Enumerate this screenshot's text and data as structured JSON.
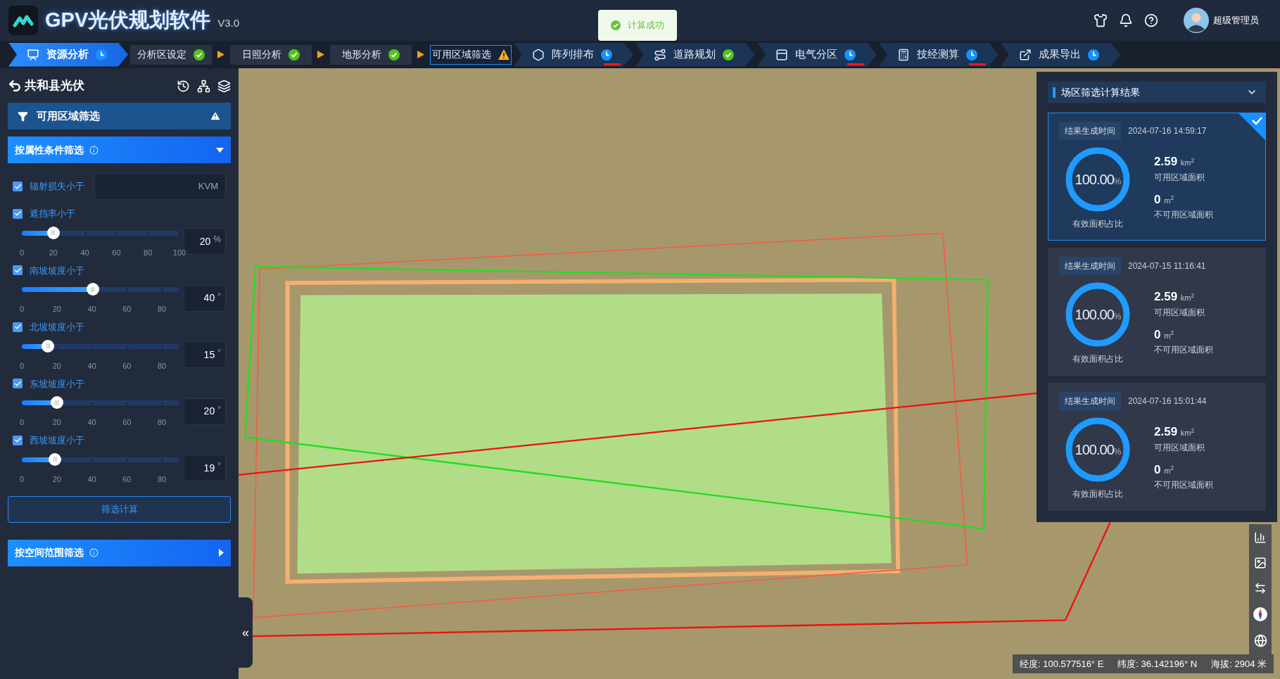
{
  "header": {
    "title": "GPV光伏规划软件",
    "version": "V3.0",
    "user": "超级管理员"
  },
  "toast": {
    "message": "计算成功"
  },
  "steps": [
    {
      "kind": "main",
      "label": "资源分析",
      "completed": false,
      "warning": false,
      "selected": true,
      "flagged": false
    },
    {
      "kind": "sub",
      "label": "分析区设定",
      "completed": true,
      "warning": false,
      "selected": false,
      "flagged": false
    },
    {
      "kind": "sub",
      "label": "日照分析",
      "completed": true,
      "warning": false,
      "selected": false,
      "flagged": false
    },
    {
      "kind": "sub",
      "label": "地形分析",
      "completed": true,
      "warning": false,
      "selected": false,
      "flagged": false
    },
    {
      "kind": "sub",
      "label": "可用区域筛选",
      "completed": false,
      "warning": true,
      "selected": true,
      "flagged": false
    },
    {
      "kind": "main",
      "label": "阵列排布",
      "completed": false,
      "warning": false,
      "selected": false,
      "flagged": true
    },
    {
      "kind": "main",
      "label": "道路规划",
      "completed": true,
      "warning": false,
      "selected": false,
      "flagged": false
    },
    {
      "kind": "main",
      "label": "电气分区",
      "completed": false,
      "warning": false,
      "selected": false,
      "flagged": true
    },
    {
      "kind": "main",
      "label": "技经测算",
      "completed": false,
      "warning": false,
      "selected": false,
      "flagged": true
    },
    {
      "kind": "main",
      "label": "成果导出",
      "completed": false,
      "warning": false,
      "selected": false,
      "flagged": false
    }
  ],
  "project": {
    "name": "共和县光伏"
  },
  "filter_panel": {
    "title": "可用区域筛选",
    "sections": [
      {
        "title": "按属性条件筛选",
        "expanded": true,
        "button": "筛选计算",
        "criteria": [
          {
            "kind": "input",
            "label": "辐射损失小于",
            "checked": true,
            "unit": "KVM"
          },
          {
            "kind": "slider",
            "label": "遮挡率小于",
            "checked": true,
            "level": 0.2,
            "value": "20",
            "unit": "%",
            "ticks": [
              "0",
              "20",
              "40",
              "60",
              "80",
              "100"
            ]
          },
          {
            "kind": "slider",
            "label": "南坡坡度小于",
            "checked": true,
            "level": 0.45,
            "value": "40",
            "unit": "°",
            "ticks": [
              "0",
              "20",
              "40",
              "60",
              "80"
            ]
          },
          {
            "kind": "slider",
            "label": "北坡坡度小于",
            "checked": true,
            "level": 0.167,
            "value": "15",
            "unit": "°",
            "ticks": [
              "0",
              "20",
              "40",
              "60",
              "80"
            ]
          },
          {
            "kind": "slider",
            "label": "东坡坡度小于",
            "checked": true,
            "level": 0.222,
            "value": "20",
            "unit": "°",
            "ticks": [
              "0",
              "20",
              "40",
              "60",
              "80"
            ]
          },
          {
            "kind": "slider",
            "label": "西坡坡度小于",
            "checked": true,
            "level": 0.211,
            "value": "19",
            "unit": "°",
            "ticks": [
              "0",
              "20",
              "40",
              "60",
              "80"
            ]
          }
        ]
      },
      {
        "title": "按空间范围筛选",
        "expanded": false
      }
    ]
  },
  "results": {
    "title": "场区筛选计算结果",
    "cards": [
      {
        "selected": true,
        "time_label": "结果生成时间",
        "time": "2024-07-16 14:59:17",
        "ratio": "100.00",
        "ratio_unit": "%",
        "ratio_label": "有效面积占比",
        "usable": "2.59",
        "usable_unit": "km$^{2}$",
        "usable_label": "可用区域面积",
        "unusable": "0",
        "unusable_unit": "m$^{2}$",
        "unusable_label": "不可用区域面积"
      },
      {
        "selected": false,
        "time_label": "结果生成时间",
        "time": "2024-07-15 11:16:41",
        "ratio": "100.00",
        "ratio_unit": "%",
        "ratio_label": "有效面积占比",
        "usable": "2.59",
        "usable_unit": "km$^{2}$",
        "usable_label": "可用区域面积",
        "unusable": "0",
        "unusable_unit": "m$^{2}$",
        "unusable_label": "不可用区域面积"
      },
      {
        "selected": false,
        "time_label": "结果生成时间",
        "time": "2024-07-16 15:01:44",
        "ratio": "100.00",
        "ratio_unit": "%",
        "ratio_label": "有效面积占比",
        "usable": "2.59",
        "usable_unit": "km$^{2}$",
        "usable_label": "可用区域面积",
        "unusable": "0",
        "unusable_unit": "m$^{2}$",
        "unusable_label": "不可用区域面积"
      }
    ]
  },
  "map": {
    "collapse": "«",
    "longitude": "经度: 100.577516° E",
    "latitude": "纬度: 36.142196° N",
    "altitude": "海拔: 2904 米"
  }
}
